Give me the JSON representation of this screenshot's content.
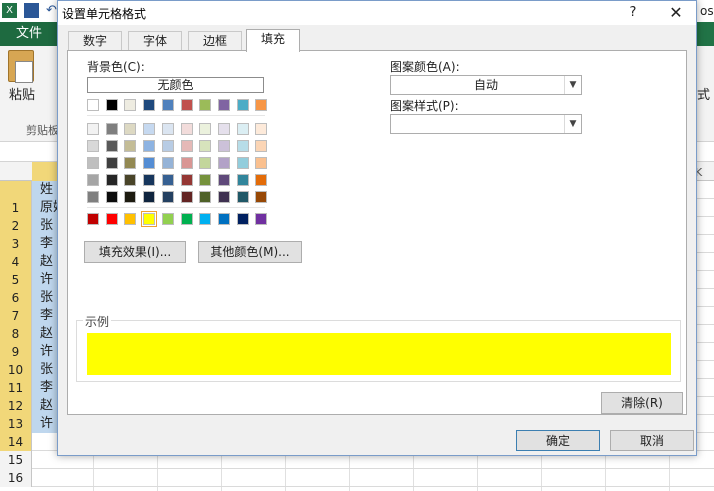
{
  "excel": {
    "file_tab": "文件",
    "paste_label": "粘贴",
    "clipboard_label": "剪贴板",
    "right_ribbon_text": "式",
    "right_title_text": "oso",
    "col_k": "K",
    "rows": [
      {
        "num": "",
        "text": "姓"
      },
      {
        "num": "1",
        "text": "原始"
      },
      {
        "num": "2",
        "text": "张"
      },
      {
        "num": "3",
        "text": "李"
      },
      {
        "num": "4",
        "text": "赵"
      },
      {
        "num": "5",
        "text": "许"
      },
      {
        "num": "6",
        "text": "张"
      },
      {
        "num": "7",
        "text": "李"
      },
      {
        "num": "8",
        "text": "赵"
      },
      {
        "num": "9",
        "text": "许"
      },
      {
        "num": "10",
        "text": "张"
      },
      {
        "num": "11",
        "text": "李"
      },
      {
        "num": "12",
        "text": "赵"
      },
      {
        "num": "13",
        "text": "许"
      },
      {
        "num": "14",
        "text": ""
      },
      {
        "num": "15",
        "text": ""
      },
      {
        "num": "16",
        "text": ""
      }
    ]
  },
  "dialog": {
    "title": "设置单元格格式",
    "help_symbol": "?",
    "close_symbol": "✕",
    "tabs": [
      {
        "label": "数字",
        "active": false
      },
      {
        "label": "字体",
        "active": false
      },
      {
        "label": "边框",
        "active": false
      },
      {
        "label": "填充",
        "active": true
      }
    ],
    "bg_color_label": "背景色(C):",
    "no_color_label": "无颜色",
    "palette_top_row": [
      "#FFFFFF",
      "#000000",
      "#EEECE1",
      "#1F497D",
      "#4F81BD",
      "#C0504D",
      "#9BBB59",
      "#8064A2",
      "#4BACC6",
      "#F79646"
    ],
    "palette_theme_rows": [
      [
        "#F2F2F2",
        "#7F7F7F",
        "#DDD9C3",
        "#C6D9F0",
        "#DBE5F1",
        "#F2DCDB",
        "#EBF1DD",
        "#E5E0EC",
        "#DBEEF3",
        "#FDEADA"
      ],
      [
        "#D8D8D8",
        "#595959",
        "#C4BD97",
        "#8DB3E2",
        "#B8CCE4",
        "#E5B9B7",
        "#D7E3BC",
        "#CCC1D9",
        "#B7DDE8",
        "#FBD5B5"
      ],
      [
        "#BFBFBF",
        "#3F3F3F",
        "#938953",
        "#548DD4",
        "#95B3D7",
        "#D99694",
        "#C3D69B",
        "#B2A2C7",
        "#92CDDC",
        "#FAC08F"
      ],
      [
        "#A5A5A5",
        "#262626",
        "#494429",
        "#17365D",
        "#366092",
        "#953734",
        "#76923C",
        "#5F497A",
        "#31859B",
        "#E36C09"
      ],
      [
        "#7F7F7F",
        "#0C0C0C",
        "#1D1B10",
        "#0F243E",
        "#244061",
        "#632423",
        "#4F6128",
        "#3F3151",
        "#205867",
        "#974806"
      ]
    ],
    "palette_standard_row": [
      "#C00000",
      "#FF0000",
      "#FFC000",
      "#FFFF00",
      "#92D050",
      "#00B050",
      "#00B0F0",
      "#0070C0",
      "#002060",
      "#7030A0"
    ],
    "selected_standard_index": 3,
    "fill_effects_label": "填充效果(I)...",
    "more_colors_label": "其他颜色(M)...",
    "pattern_color_label": "图案颜色(A):",
    "pattern_color_value": "自动",
    "pattern_style_label": "图案样式(P):",
    "pattern_style_value": "",
    "sample_label": "示例",
    "sample_color": "#FFFF00",
    "clear_label": "清除(R)",
    "ok_label": "确定",
    "cancel_label": "取消"
  }
}
